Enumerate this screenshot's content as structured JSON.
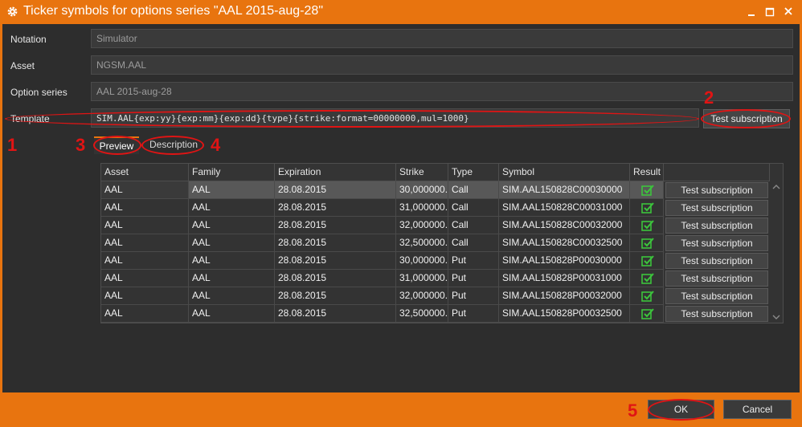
{
  "window": {
    "title": "Ticker symbols for options series \"AAL 2015-aug-28\""
  },
  "fields": {
    "notation": {
      "label": "Notation",
      "value": "Simulator"
    },
    "asset": {
      "label": "Asset",
      "value": "NGSM.AAL"
    },
    "option_series": {
      "label": "Option series",
      "value": "AAL 2015-aug-28"
    },
    "template": {
      "label": "Template",
      "value": "SIM.AAL{exp:yy}{exp:mm}{exp:dd}{type}{strike:format=00000000,mul=1000}"
    }
  },
  "buttons": {
    "test_subscription": "Test subscription",
    "ok": "OK",
    "cancel": "Cancel"
  },
  "tabs": [
    {
      "label": "Preview",
      "active": true
    },
    {
      "label": "Description",
      "active": false
    }
  ],
  "grid": {
    "columns": [
      "Asset",
      "Family",
      "Expiration",
      "Strike",
      "Type",
      "Symbol",
      "Result"
    ],
    "rows": [
      {
        "asset": "AAL",
        "family": "AAL",
        "expiration": "28.08.2015",
        "strike": "30,000000...",
        "type": "Call",
        "symbol": "SIM.AAL150828C00030000",
        "action": "Test subscription"
      },
      {
        "asset": "AAL",
        "family": "AAL",
        "expiration": "28.08.2015",
        "strike": "31,000000...",
        "type": "Call",
        "symbol": "SIM.AAL150828C00031000",
        "action": "Test subscription"
      },
      {
        "asset": "AAL",
        "family": "AAL",
        "expiration": "28.08.2015",
        "strike": "32,000000...",
        "type": "Call",
        "symbol": "SIM.AAL150828C00032000",
        "action": "Test subscription"
      },
      {
        "asset": "AAL",
        "family": "AAL",
        "expiration": "28.08.2015",
        "strike": "32,500000...",
        "type": "Call",
        "symbol": "SIM.AAL150828C00032500",
        "action": "Test subscription"
      },
      {
        "asset": "AAL",
        "family": "AAL",
        "expiration": "28.08.2015",
        "strike": "30,000000...",
        "type": "Put",
        "symbol": "SIM.AAL150828P00030000",
        "action": "Test subscription"
      },
      {
        "asset": "AAL",
        "family": "AAL",
        "expiration": "28.08.2015",
        "strike": "31,000000...",
        "type": "Put",
        "symbol": "SIM.AAL150828P00031000",
        "action": "Test subscription"
      },
      {
        "asset": "AAL",
        "family": "AAL",
        "expiration": "28.08.2015",
        "strike": "32,000000...",
        "type": "Put",
        "symbol": "SIM.AAL150828P00032000",
        "action": "Test subscription"
      },
      {
        "asset": "AAL",
        "family": "AAL",
        "expiration": "28.08.2015",
        "strike": "32,500000...",
        "type": "Put",
        "symbol": "SIM.AAL150828P00032500",
        "action": "Test subscription"
      }
    ]
  },
  "annotations": [
    "1",
    "2",
    "3",
    "4",
    "5"
  ],
  "colors": {
    "accent": "#e8740f",
    "background": "#2d2d2d",
    "success": "#3cc43c",
    "annotation": "#e01414"
  },
  "icons": {
    "title": "gear-icon",
    "minimize": "minimize-icon",
    "maximize": "maximize-icon",
    "close": "close-icon",
    "result": "check-icon"
  }
}
